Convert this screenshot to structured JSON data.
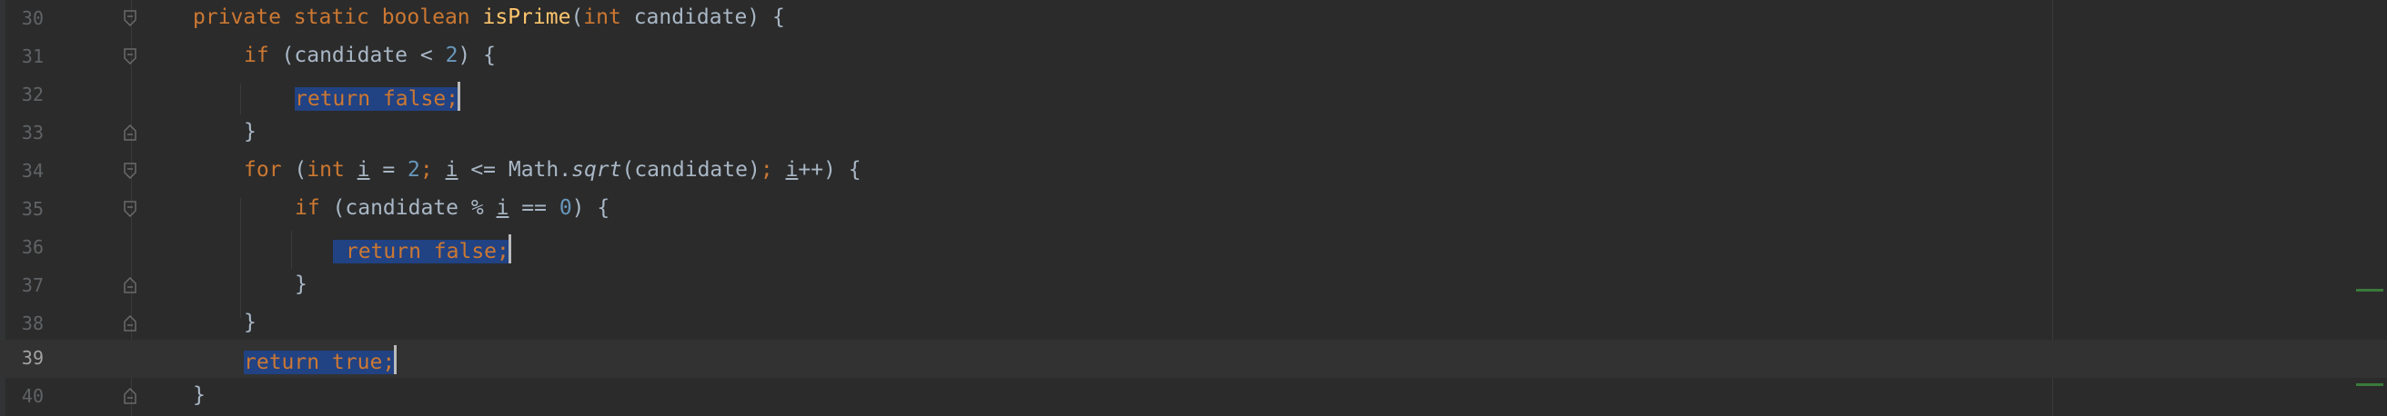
{
  "editor": {
    "language": "Java",
    "current_line": 39,
    "colors": {
      "background": "#2b2b2b",
      "keyword": "#cc7832",
      "function": "#ffc66d",
      "number": "#6897bb",
      "text": "#a9b7c6",
      "selection": "#214283"
    },
    "lines": [
      {
        "num": "30",
        "code": "private static boolean isPrime(int candidate) {"
      },
      {
        "num": "31",
        "code": "if (candidate < 2) {"
      },
      {
        "num": "32",
        "code": "return false;"
      },
      {
        "num": "33",
        "code": "}"
      },
      {
        "num": "34",
        "code": "for (int i = 2; i <= Math.sqrt(candidate); i++) {"
      },
      {
        "num": "35",
        "code": "if (candidate % i == 0) {"
      },
      {
        "num": "36",
        "code": "return false;"
      },
      {
        "num": "37",
        "code": "}"
      },
      {
        "num": "38",
        "code": "}"
      },
      {
        "num": "39",
        "code": "return true;"
      },
      {
        "num": "40",
        "code": "}"
      }
    ]
  }
}
